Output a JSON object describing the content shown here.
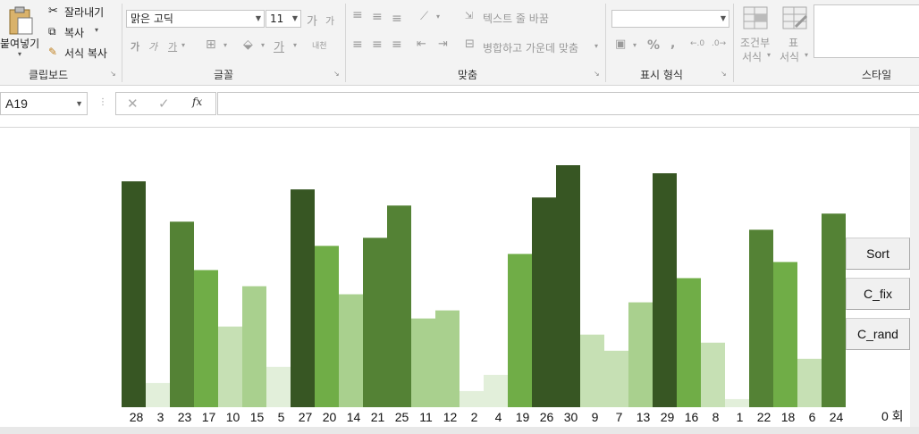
{
  "ribbon": {
    "clipboard": {
      "paste_label": "붙여넣기",
      "cut_label": "잘라내기",
      "copy_label": "복사",
      "format_painter_label": "서식 복사",
      "group_label": "클립보드"
    },
    "font": {
      "font_name": "맑은 고딕",
      "font_size": "11",
      "grow_label": "가",
      "shrink_label": "가",
      "bold_label": "가",
      "italic_label": "가",
      "underline_label": "가",
      "font_color_label": "가",
      "phonetic_label": "내천",
      "group_label": "글꼴"
    },
    "alignment": {
      "wrap_text_label": "텍스트 줄 바꿈",
      "merge_center_label": "병합하고 가운데 맞춤",
      "group_label": "맞춤"
    },
    "number": {
      "format_value": "",
      "percent_label": "%",
      "comma_label": ",",
      "group_label": "표시 형식"
    },
    "styles": {
      "conditional_label_1": "조건부",
      "conditional_label_2": "서식",
      "table_label_1": "표",
      "table_label_2": "서식",
      "group_label": "스타일"
    }
  },
  "formula_bar": {
    "name_box": "A19",
    "fx_label": "fx",
    "formula": ""
  },
  "colors": {
    "dark": "#375623",
    "medium_dark": "#548235",
    "medium": "#70ad47",
    "light": "#a9d08e",
    "lighter": "#c6e0b4",
    "lightest": "#e2efda"
  },
  "chart_data": {
    "type": "bar",
    "categories": [
      "28",
      "3",
      "23",
      "17",
      "10",
      "15",
      "5",
      "27",
      "20",
      "14",
      "21",
      "25",
      "11",
      "12",
      "2",
      "4",
      "19",
      "26",
      "30",
      "9",
      "7",
      "13",
      "29",
      "16",
      "8",
      "1",
      "22",
      "18",
      "6",
      "24"
    ],
    "values": [
      28,
      3,
      23,
      17,
      10,
      15,
      5,
      27,
      20,
      14,
      21,
      25,
      11,
      12,
      2,
      4,
      19,
      26,
      30,
      9,
      7,
      13,
      29,
      16,
      8,
      1,
      22,
      18,
      6,
      24
    ],
    "ylim": [
      0,
      30
    ],
    "grid": false,
    "legend": "none"
  },
  "buttons": {
    "sort_label": "Sort",
    "cfix_label": "C_fix",
    "crand_label": "C_rand"
  },
  "counter_label": "0 회"
}
